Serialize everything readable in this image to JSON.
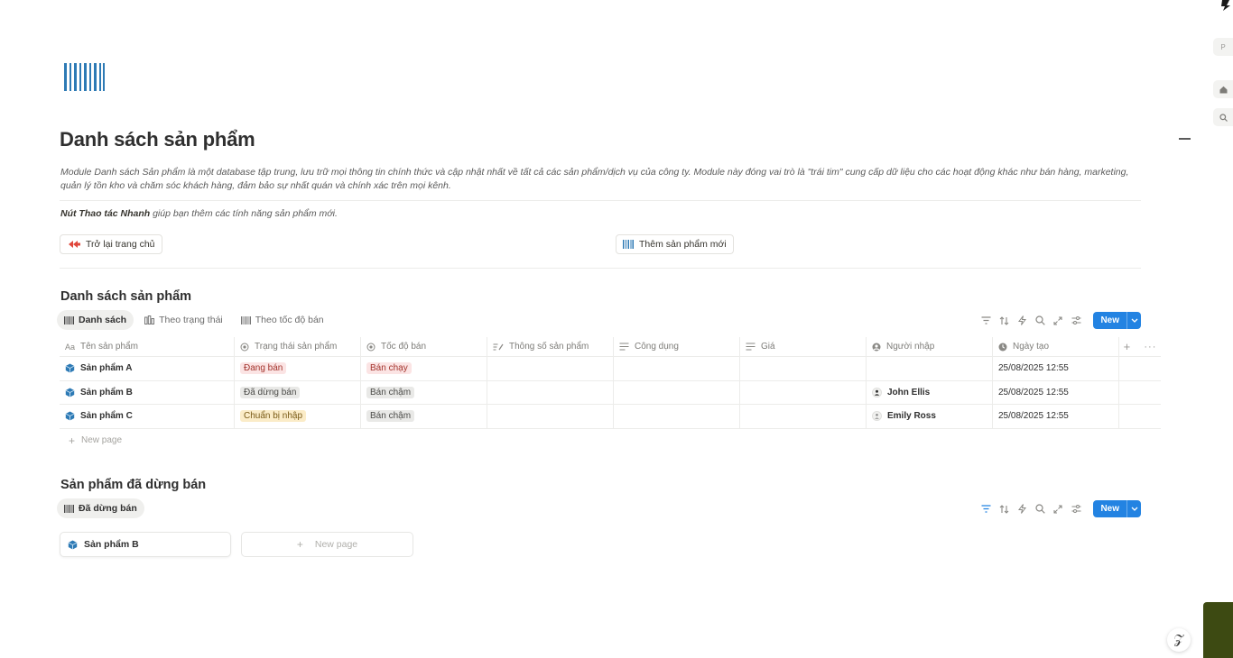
{
  "page": {
    "title": "Danh sách sản phẩm",
    "description": "Module Danh sách Sản phẩm là một database tập trung, lưu trữ mọi thông tin chính thức và cập nhật nhất về tất cả các sản phẩm/dịch vụ của công ty. Module này đóng vai trò là \"trái tim\" cung cấp dữ liệu cho các hoạt động khác như bán hàng, marketing, quản lý tồn kho và chăm sóc khách hàng, đảm bảo sự nhất quán và chính xác trên mọi kênh.",
    "quick_note_bold": "Nút Thao tác Nhanh",
    "quick_note_rest": " giúp bạn thêm các tính năng sản phẩm mới.",
    "icon": "barcode-icon"
  },
  "buttons": {
    "back_home": "Trở lại trang chủ",
    "add_product": "Thêm sản phẩm mới"
  },
  "section1": {
    "title": "Danh sách sản phẩm",
    "tabs": [
      {
        "label": "Danh sách",
        "icon": "barcode-icon",
        "active": true
      },
      {
        "label": "Theo trạng thái",
        "icon": "board-icon",
        "active": false
      },
      {
        "label": "Theo tốc độ bán",
        "icon": "barcode-icon",
        "active": false
      }
    ],
    "new_label": "New",
    "columns": [
      "Tên sản phẩm",
      "Trạng thái sản phẩm",
      "Tốc độ bán",
      "Thông số sản phẩm",
      "Công dụng",
      "Giá",
      "Người nhập",
      "Ngày tạo"
    ],
    "rows": [
      {
        "name": "Sản phẩm A",
        "status": "Đang bán",
        "status_color": "red",
        "speed": "Bán chạy",
        "speed_color": "red",
        "person": "",
        "date": "25/08/2025 12:55"
      },
      {
        "name": "Sản phẩm B",
        "status": "Đã dừng bán",
        "status_color": "gray",
        "speed": "Bán chậm",
        "speed_color": "gray",
        "person": "John Ellis",
        "date": "25/08/2025 12:55"
      },
      {
        "name": "Sản phẩm C",
        "status": "Chuẩn bị nhập",
        "status_color": "yellow",
        "speed": "Bán chậm",
        "speed_color": "gray",
        "person": "Emily Ross",
        "date": "25/08/2025 12:55"
      }
    ],
    "new_page": "New page"
  },
  "section2": {
    "title": "Sản phẩm đã dừng bán",
    "tabs": [
      {
        "label": "Đã dừng bán",
        "icon": "barcode-icon",
        "active": true
      }
    ],
    "new_label": "New",
    "cards": [
      {
        "name": "Sản phẩm B"
      }
    ],
    "new_page": "New page"
  },
  "colors": {
    "accent": "#2383e2",
    "barcode": "#2d7ab5",
    "back_arrow": "#e0473b"
  }
}
